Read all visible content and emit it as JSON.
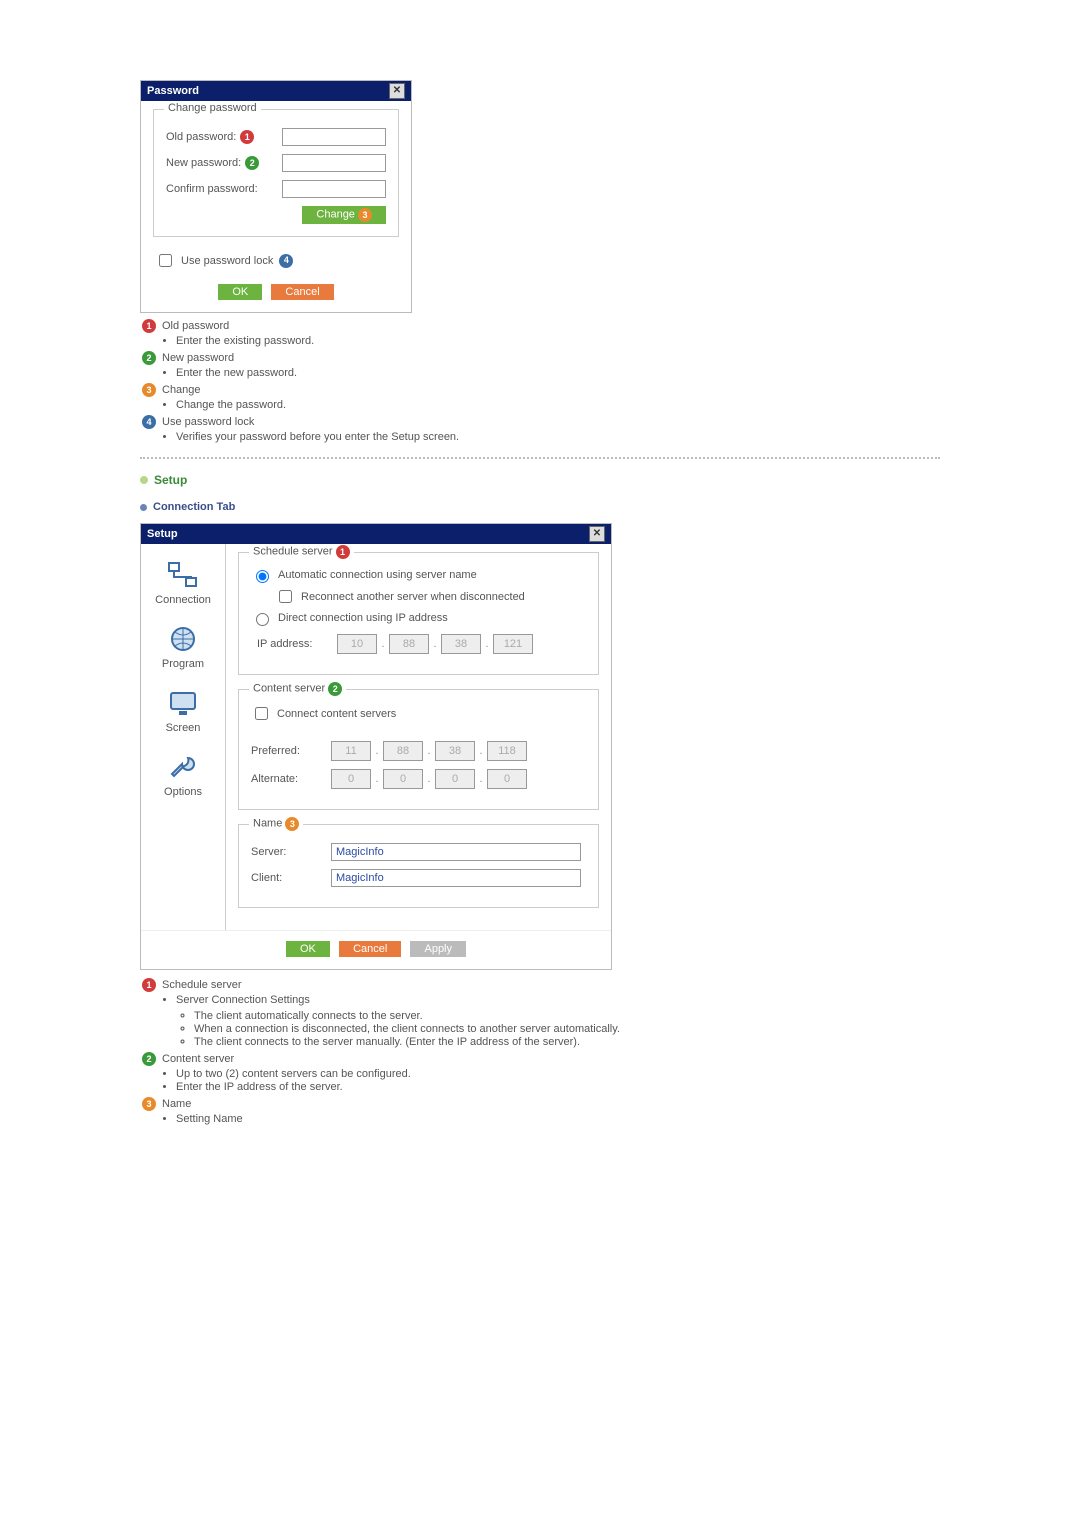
{
  "password_dialog": {
    "title": "Password",
    "fieldset": "Change password",
    "old_label": "Old password:",
    "new_label": "New password:",
    "confirm_label": "Confirm password:",
    "change_btn": "Change",
    "lock_label": "Use password lock",
    "ok": "OK",
    "cancel": "Cancel"
  },
  "pw_desc": {
    "items": [
      {
        "n": "1",
        "t": "Old password",
        "bullets": [
          "Enter the existing password."
        ]
      },
      {
        "n": "2",
        "t": "New password",
        "bullets": [
          "Enter the new password."
        ]
      },
      {
        "n": "3",
        "t": "Change",
        "bullets": [
          "Change the password."
        ]
      },
      {
        "n": "4",
        "t": "Use password lock",
        "bullets": [
          "Verifies your password before you enter the Setup screen."
        ]
      }
    ]
  },
  "setup_heading": "Setup",
  "connection_heading": "Connection Tab",
  "setup_dialog": {
    "title": "Setup",
    "tabs": {
      "connection": "Connection",
      "program": "Program",
      "screen": "Screen",
      "options": "Options"
    },
    "schedule": {
      "legend": "Schedule server",
      "auto": "Automatic connection using server name",
      "reconnect": "Reconnect another server when disconnected",
      "direct": "Direct connection using IP address",
      "ip_label": "IP address:",
      "ip": [
        "10",
        "88",
        "38",
        "121"
      ]
    },
    "content": {
      "legend": "Content server",
      "connect": "Connect content servers",
      "preferred_label": "Preferred:",
      "preferred": [
        "11",
        "88",
        "38",
        "118"
      ],
      "alternate_label": "Alternate:",
      "alternate": [
        "0",
        "0",
        "0",
        "0"
      ]
    },
    "name": {
      "legend": "Name",
      "server_label": "Server:",
      "server": "MagicInfo",
      "client_label": "Client:",
      "client": "MagicInfo"
    },
    "ok": "OK",
    "cancel": "Cancel",
    "apply": "Apply"
  },
  "setup_desc": {
    "items": [
      {
        "n": "1",
        "t": "Schedule server",
        "bullets": [
          "Server Connection Settings"
        ],
        "sub": [
          "The client automatically connects to the server.",
          "When a connection is disconnected, the client connects to another server automatically.",
          "The client connects to the server manually. (Enter the IP address of the server)."
        ]
      },
      {
        "n": "2",
        "t": "Content server",
        "bullets": [
          "Up to two (2) content servers can be configured.",
          "Enter the IP address of the server."
        ]
      },
      {
        "n": "3",
        "t": "Name",
        "bullets": [
          "Setting Name"
        ]
      }
    ]
  }
}
